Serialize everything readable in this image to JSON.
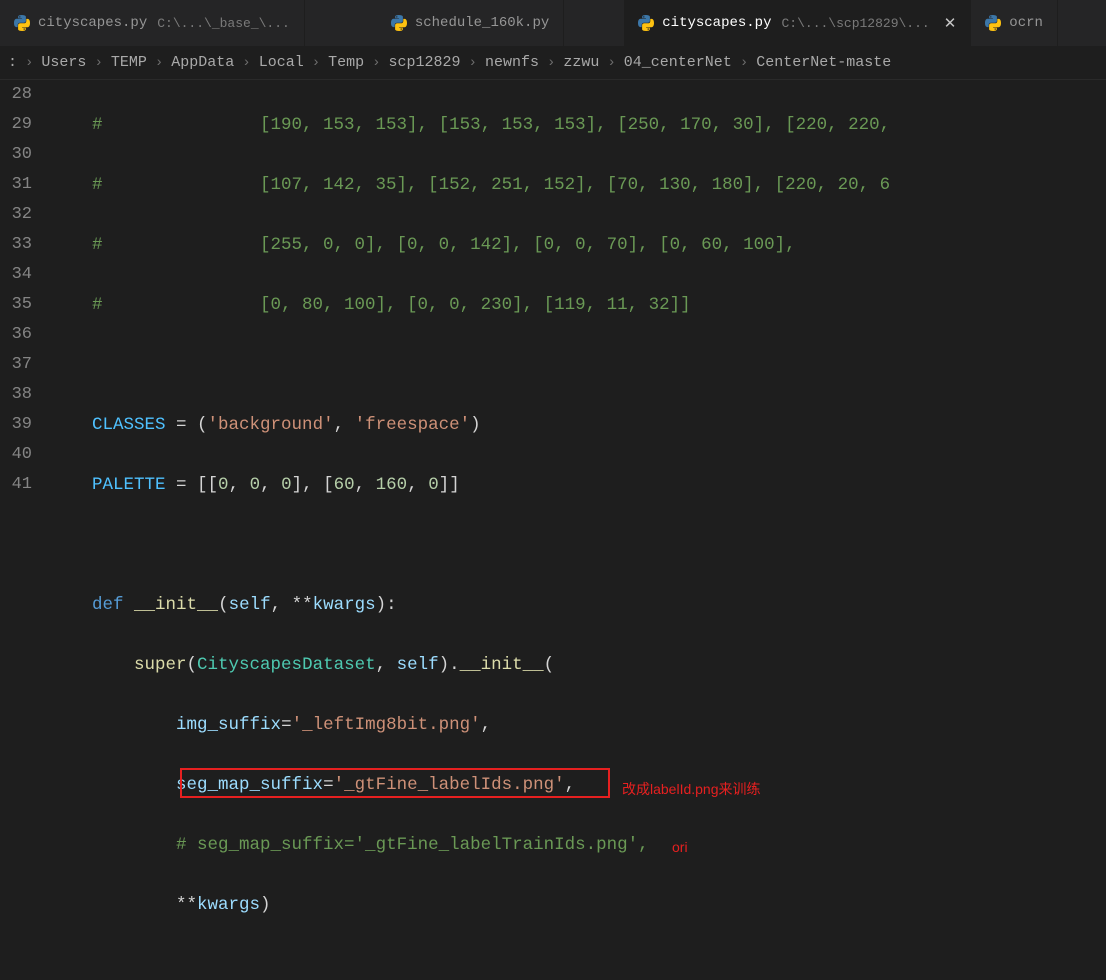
{
  "tabs": [
    {
      "icon": "python",
      "label": "cityscapes.py",
      "detail": "C:\\...\\_base_\\...",
      "close": false,
      "active": false
    },
    {
      "icon": "python",
      "label": "schedule_160k.py",
      "detail": "",
      "close": false,
      "active": false
    },
    {
      "icon": "python",
      "label": "cityscapes.py",
      "detail": "C:\\...\\scp12829\\...",
      "close": true,
      "active": true
    },
    {
      "icon": "python",
      "label": "ocrn",
      "detail": "",
      "close": false,
      "active": false
    }
  ],
  "breadcrumbs": [
    ":",
    "Users",
    "TEMP",
    "AppData",
    "Local",
    "Temp",
    "scp12829",
    "newnfs",
    "zzwu",
    "04_centerNet",
    "CenterNet-maste"
  ],
  "gutter": [
    "28",
    "29",
    "30",
    "31",
    "32",
    "33",
    "34",
    "35",
    "36",
    "37",
    "38",
    "39",
    "40",
    "41",
    ""
  ],
  "code": {
    "l28": "    #               [190, 153, 153], [153, 153, 153], [250, 170, 30], [220, 220,",
    "l29": "    #               [107, 142, 35], [152, 251, 152], [70, 130, 180], [220, 20, 6",
    "l30": "    #               [255, 0, 0], [0, 0, 142], [0, 0, 70], [0, 60, 100],",
    "l31": "    #               [0, 80, 100], [0, 0, 230], [119, 11, 32]]",
    "l32": "",
    "l33_a": "    ",
    "l33_b": "CLASSES",
    "l33_c": " = (",
    "l33_d": "'background'",
    "l33_e": ", ",
    "l33_f": "'freespace'",
    "l33_g": ")",
    "l34_a": "    ",
    "l34_b": "PALETTE",
    "l34_c": " = [[",
    "l34_d": "0",
    "l34_e": ", ",
    "l34_f": "0",
    "l34_g": ", ",
    "l34_h": "0",
    "l34_i": "], [",
    "l34_j": "60",
    "l34_k": ", ",
    "l34_l": "160",
    "l34_m": ", ",
    "l34_n": "0",
    "l34_o": "]]",
    "l35": "",
    "l36_a": "    ",
    "l36_b": "def",
    "l36_c": " ",
    "l36_d": "__init__",
    "l36_e": "(",
    "l36_f": "self",
    "l36_g": ", **",
    "l36_h": "kwargs",
    "l36_i": "):",
    "l37_a": "        ",
    "l37_b": "super",
    "l37_c": "(",
    "l37_d": "CityscapesDataset",
    "l37_e": ", ",
    "l37_f": "self",
    "l37_g": ").",
    "l37_h": "__init__",
    "l37_i": "(",
    "l38_a": "            ",
    "l38_b": "img_suffix",
    "l38_c": "=",
    "l38_d": "'_leftImg8bit.png'",
    "l38_e": ",",
    "l39_a": "            ",
    "l39_b": "seg_map_suffix",
    "l39_c": "=",
    "l39_d": "'_gtFine_labelIds.png'",
    "l39_e": ",",
    "l40_a": "            ",
    "l40_b": "# seg_map_suffix='_gtFine_labelTrainIds.png',",
    "l41_a": "            **",
    "l41_b": "kwargs",
    "l41_c": ")"
  },
  "annotations": {
    "a39": "改成labelId.png来训练",
    "a40": "ori"
  }
}
